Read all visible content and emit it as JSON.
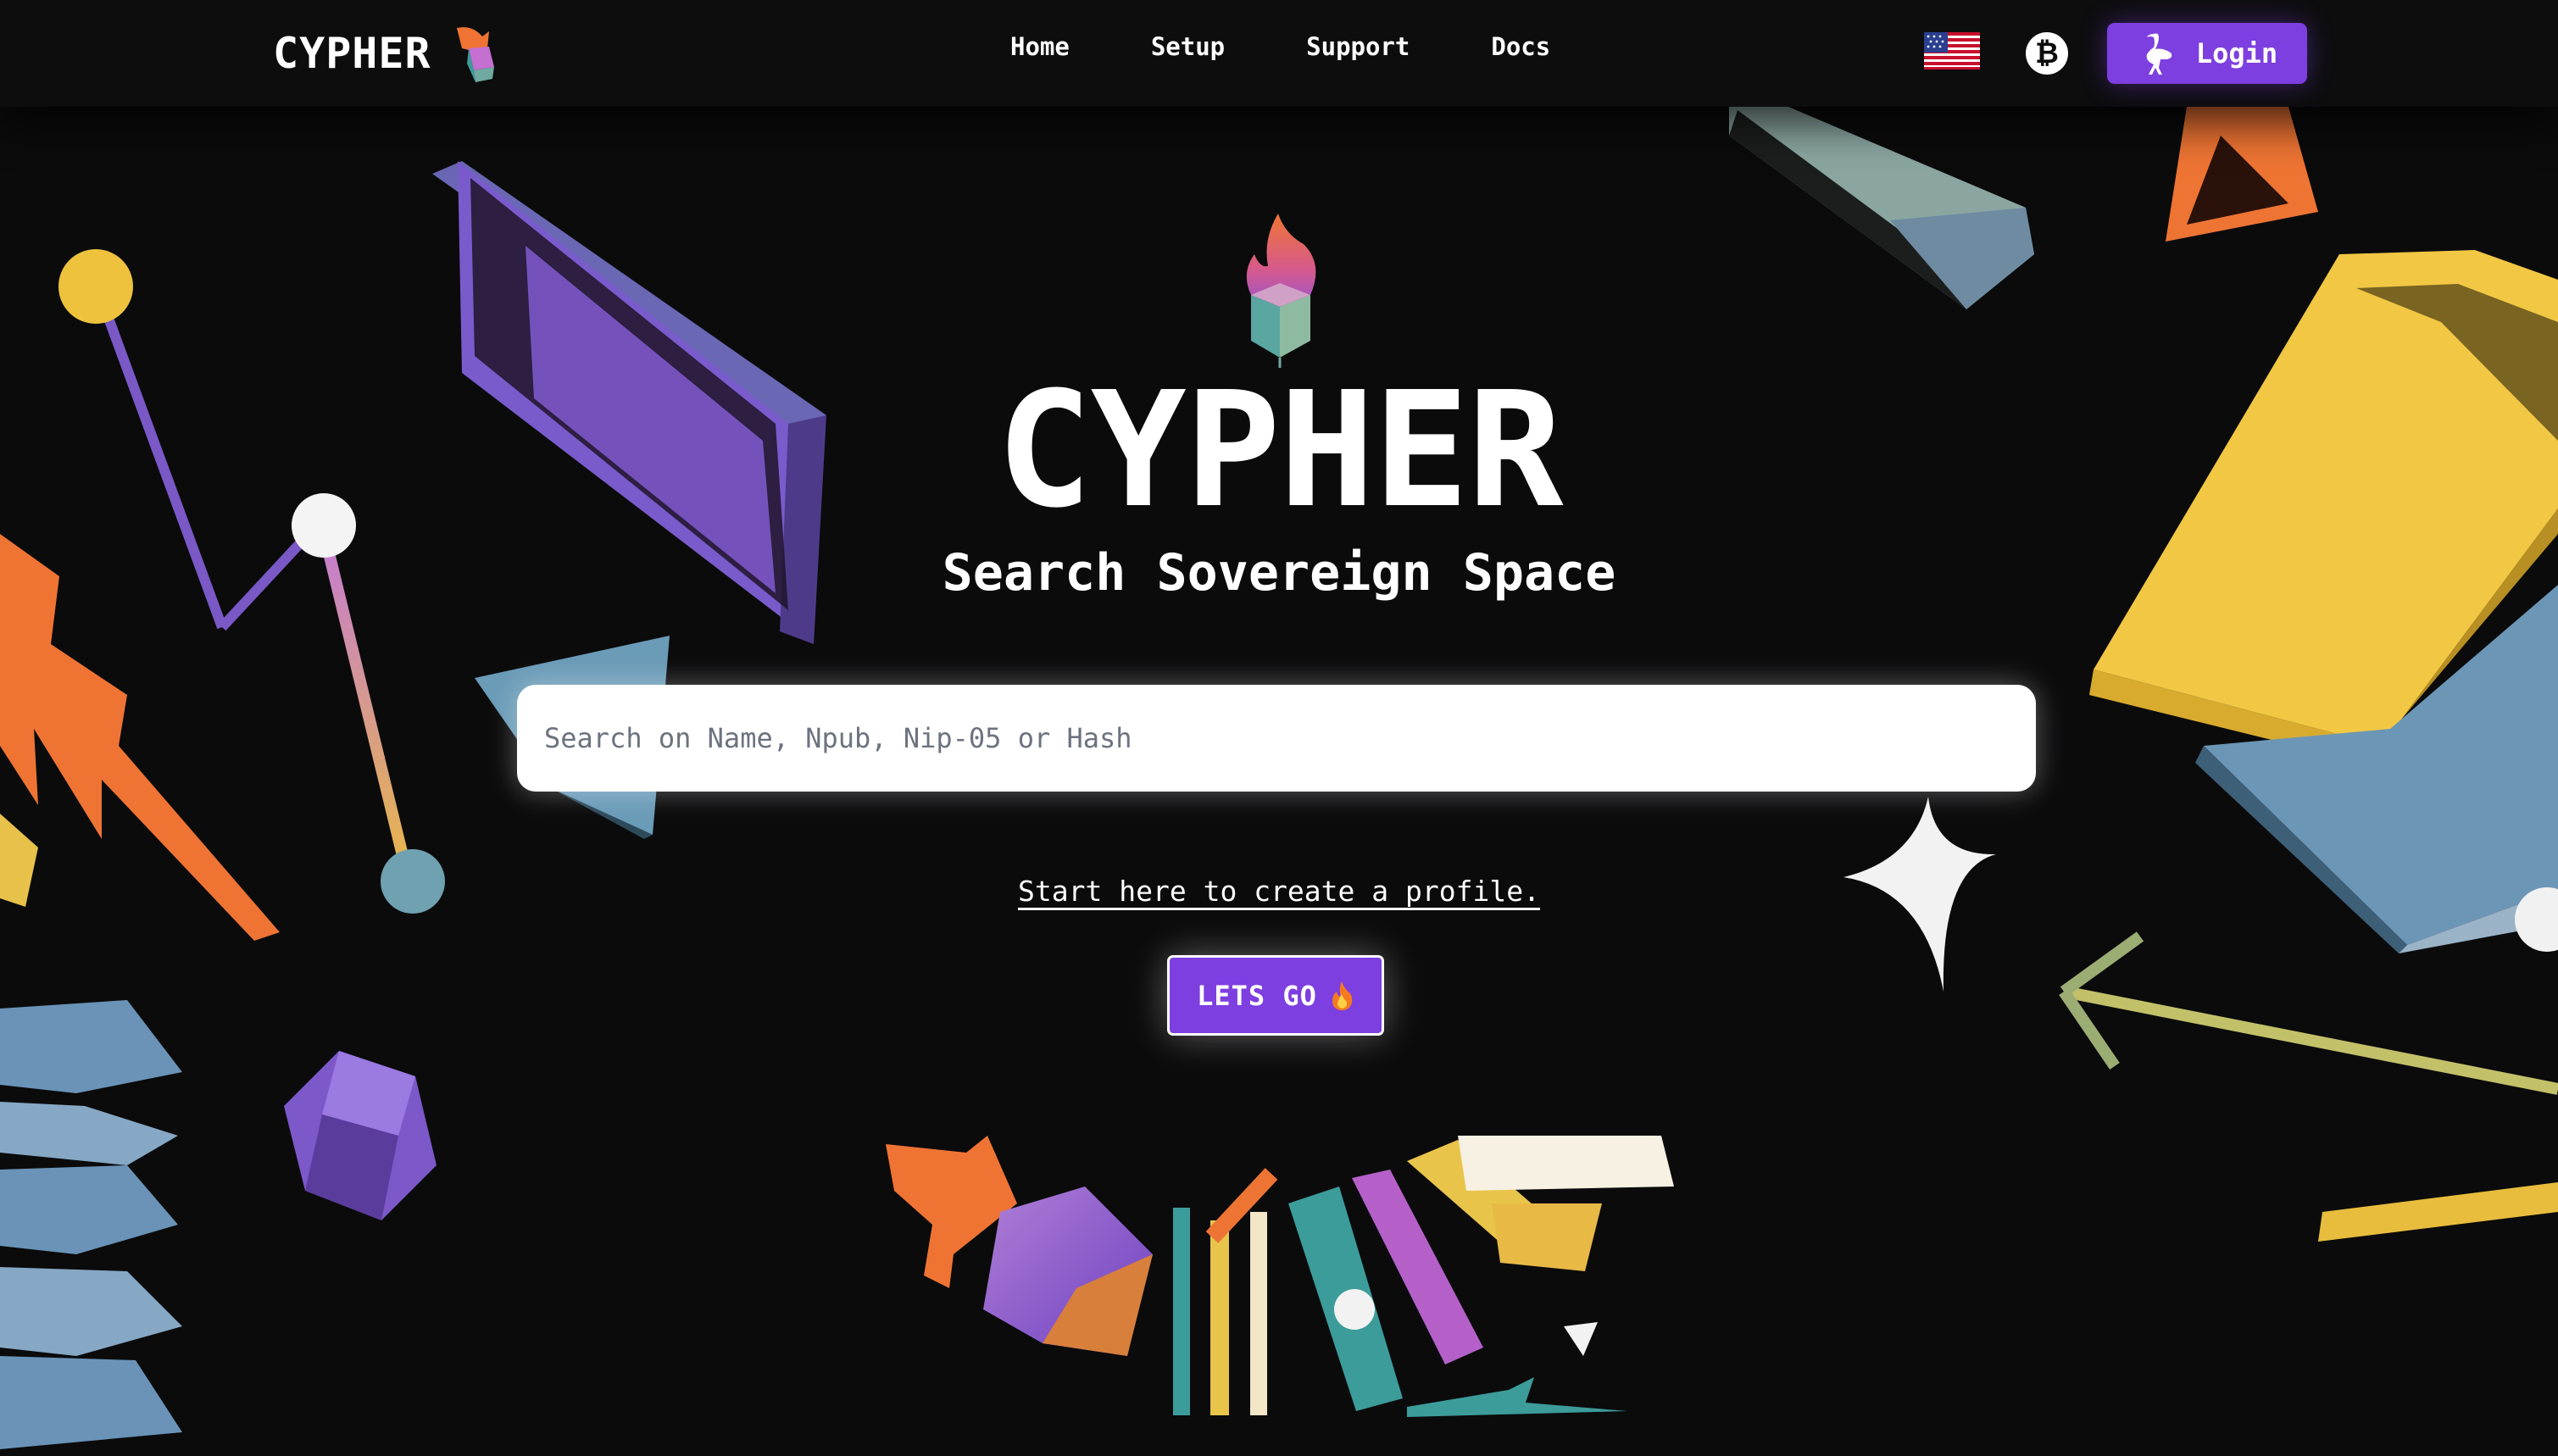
{
  "header": {
    "brand": "CYPHER",
    "nav": [
      {
        "label": "Home"
      },
      {
        "label": "Setup"
      },
      {
        "label": "Support"
      },
      {
        "label": "Docs"
      }
    ],
    "language_icon": "us-flag-icon",
    "bitcoin_icon": "bitcoin-icon",
    "login_label": "Login",
    "login_icon": "ostrich-icon"
  },
  "hero": {
    "title": "CYPHER",
    "subtitle": "Search Sovereign Space",
    "search_placeholder": "Search on Name, Npub, Nip-05 or Hash",
    "search_value": "",
    "create_link": "Start here to create a profile.",
    "cta_label": "LETS GO",
    "cta_icon": "fire-icon"
  },
  "colors": {
    "background": "#0b0b0c",
    "accent": "#7d3fe0",
    "art_purple": "#7c5bd0",
    "art_yellow": "#f2c744",
    "art_blue": "#6f97b4",
    "art_orange": "#ee7433",
    "art_teal": "#3c9c9a"
  }
}
